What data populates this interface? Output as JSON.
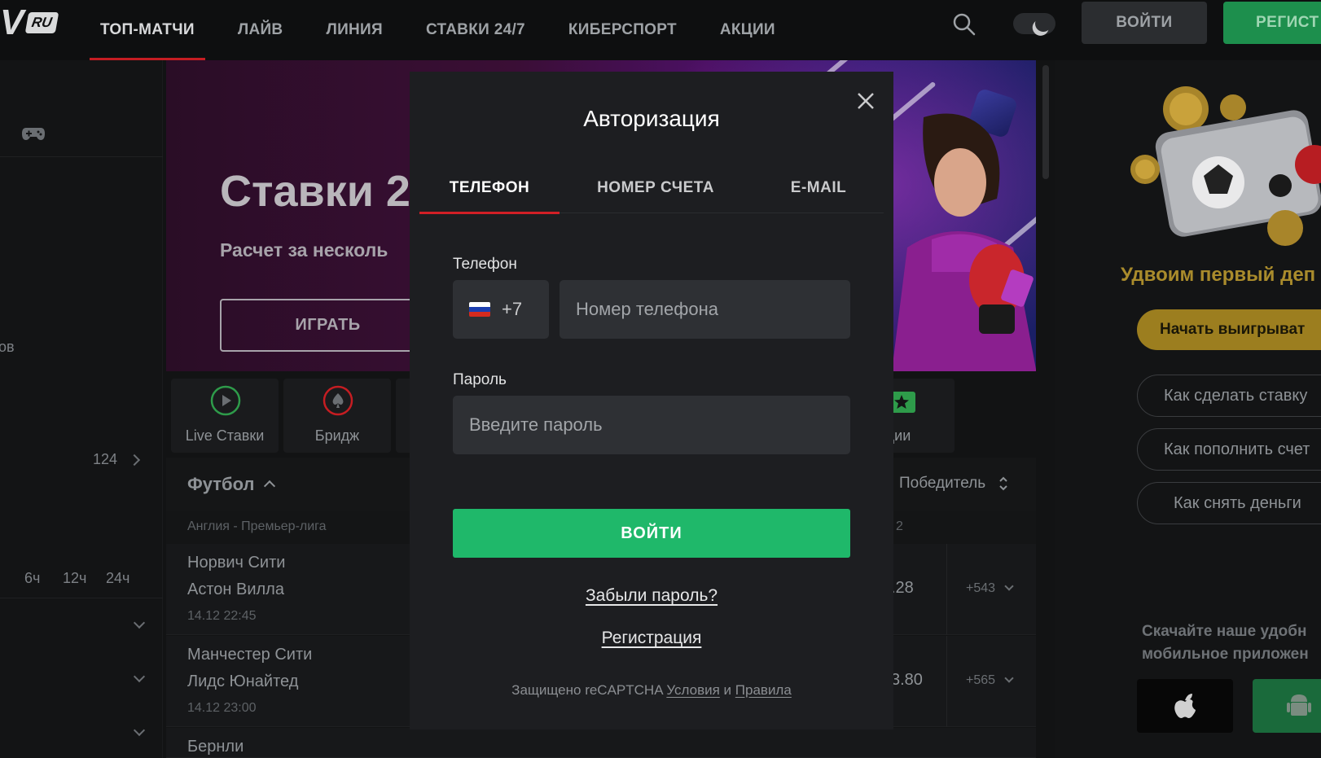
{
  "header": {
    "logo_suffix": "RU",
    "nav": [
      {
        "label": "ТОП-МАТЧИ",
        "active": true
      },
      {
        "label": "ЛАЙВ",
        "active": false
      },
      {
        "label": "ЛИНИЯ",
        "active": false
      },
      {
        "label": "СТАВКИ 24/7",
        "active": false
      },
      {
        "label": "КИБЕРСПОРТ",
        "active": false
      },
      {
        "label": "АКЦИИ",
        "active": false
      }
    ],
    "login_label": "ВОЙТИ",
    "register_label": "РЕГИСТ"
  },
  "sidebar": {
    "partial_label": "ов",
    "count": "124",
    "time_filters": [
      "6ч",
      "12ч",
      "24ч"
    ]
  },
  "banner": {
    "title": "Ставки 24",
    "subtitle": "Расчет за несколь",
    "button": "ИГРАТЬ"
  },
  "categories": [
    {
      "label": "Live Ставки",
      "icon": "play-icon",
      "color": "#2e9b4a"
    },
    {
      "label": "Бридж",
      "icon": "spade-icon",
      "color": "#c51d22"
    },
    {
      "label": "кции",
      "icon": "star-ticket-icon",
      "color": "#2e9b4a"
    }
  ],
  "matches_section": {
    "sport": "Футбол",
    "market": "Победитель",
    "league": "Англия - Премьер-лига",
    "column_2_header": "2",
    "matches": [
      {
        "home": "Норвич Сити",
        "away": "Астон Вилла",
        "time": "14.12 22:45",
        "odd": ".28",
        "more": "+543"
      },
      {
        "home": "Манчестер Сити",
        "away": "Лидс Юнайтед",
        "time": "14.12 23:00",
        "odd": "3.80",
        "more": "+565"
      },
      {
        "home": "Бернли",
        "away": "",
        "time": "",
        "odd": "",
        "more": ""
      }
    ]
  },
  "right_panel": {
    "promo_text": "Удвоим первый деп",
    "promo_button": "Начать выигрыват",
    "help_buttons": [
      "Как сделать ставку",
      "Как пополнить счет",
      "Как снять деньги"
    ],
    "app_text_line1": "Скачайте наше удобн",
    "app_text_line2": "мобильное приложен"
  },
  "modal": {
    "title": "Авторизация",
    "tabs": [
      {
        "label": "ТЕЛЕФОН",
        "active": true
      },
      {
        "label": "НОМЕР СЧЕТА",
        "active": false
      },
      {
        "label": "E-MAIL",
        "active": false
      }
    ],
    "phone_label": "Телефон",
    "country_code": "+7",
    "phone_placeholder": "Номер телефона",
    "password_label": "Пароль",
    "password_placeholder": "Введите пароль",
    "submit_label": "ВОЙТИ",
    "forgot_label": "Забыли пароль?",
    "register_label": "Регистрация",
    "captcha_prefix": "Защищено reCAPTCHA",
    "captcha_terms": "Условия",
    "captcha_and": "и",
    "captcha_privacy": "Правила"
  },
  "colors": {
    "accent_red": "#d11f26",
    "accent_green": "#1fb86a",
    "modal_bg": "#1d1e21",
    "input_bg": "#2e3034"
  }
}
